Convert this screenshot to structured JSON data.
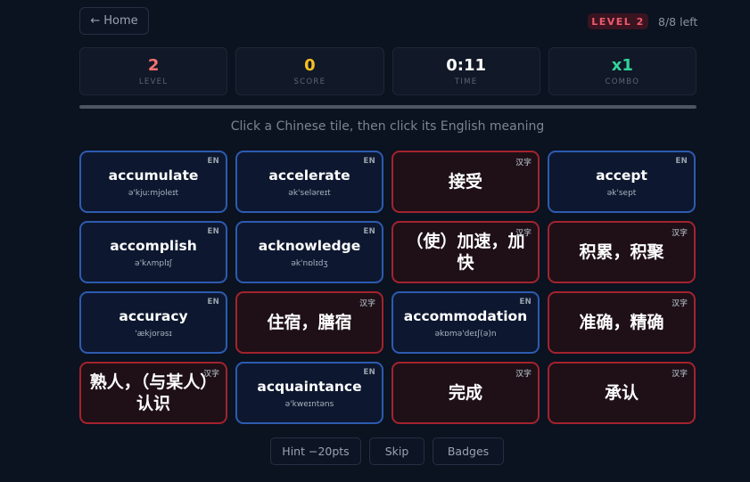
{
  "nav": {
    "home_icon": "left-arrow-icon",
    "home_arrow": "←",
    "home_label": "Home"
  },
  "header": {
    "level_badge": "LEVEL 2",
    "left_count": "8/8 left"
  },
  "stats": [
    {
      "value": "2",
      "label": "LEVEL",
      "color": "#f87171"
    },
    {
      "value": "0",
      "label": "SCORE",
      "color": "#fbbf24"
    },
    {
      "value": "0:11",
      "label": "TIME",
      "color": "#ffffff"
    },
    {
      "value": "x1",
      "label": "COMBO",
      "color": "#34d399"
    }
  ],
  "progress": {
    "fraction": 1.0
  },
  "instruction": "Click a Chinese tile, then click its English meaning",
  "tiles": [
    {
      "type": "en",
      "tag": "EN",
      "word": "accumulate",
      "phonetic": "ə'kjuːmjoleɪt"
    },
    {
      "type": "en",
      "tag": "EN",
      "word": "accelerate",
      "phonetic": "ək'seləreɪt"
    },
    {
      "type": "zh",
      "tag": "汉字",
      "text": "接受"
    },
    {
      "type": "en",
      "tag": "EN",
      "word": "accept",
      "phonetic": "ək'sept"
    },
    {
      "type": "en",
      "tag": "EN",
      "word": "accomplish",
      "phonetic": "ə'kʌmplɪʃ"
    },
    {
      "type": "en",
      "tag": "EN",
      "word": "acknowledge",
      "phonetic": "ək'nɒlɪdʒ"
    },
    {
      "type": "zh",
      "tag": "汉字",
      "text": "（使）加速，加快"
    },
    {
      "type": "zh",
      "tag": "汉字",
      "text": "积累，积聚"
    },
    {
      "type": "en",
      "tag": "EN",
      "word": "accuracy",
      "phonetic": "'ækjorəsɪ"
    },
    {
      "type": "zh",
      "tag": "汉字",
      "text": "住宿，膳宿"
    },
    {
      "type": "en",
      "tag": "EN",
      "word": "accommodation",
      "phonetic": "əkɒmə'deɪʃ(ə)n"
    },
    {
      "type": "zh",
      "tag": "汉字",
      "text": "准确，精确"
    },
    {
      "type": "zh",
      "tag": "汉字",
      "text": "熟人，（与某人）认识"
    },
    {
      "type": "en",
      "tag": "EN",
      "word": "acquaintance",
      "phonetic": "ə'kweɪntəns"
    },
    {
      "type": "zh",
      "tag": "汉字",
      "text": "完成"
    },
    {
      "type": "zh",
      "tag": "汉字",
      "text": "承认"
    }
  ],
  "footer": {
    "hint": "Hint −20pts",
    "skip": "Skip",
    "badges": "Badges"
  }
}
